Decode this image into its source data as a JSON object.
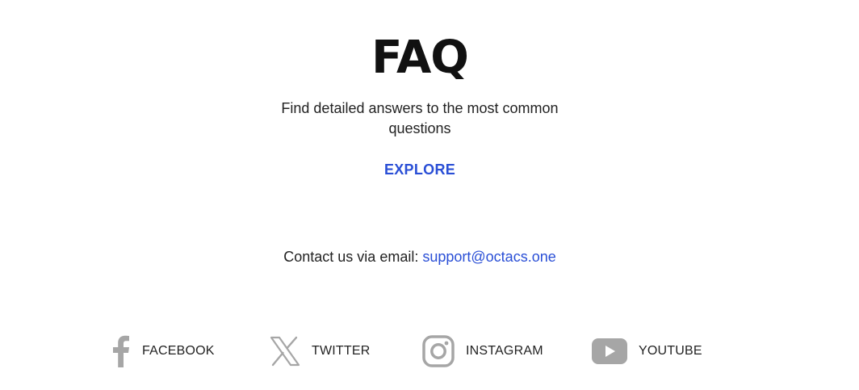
{
  "faq": {
    "title": "FAQ",
    "subtitle": "Find detailed answers to the most common questions",
    "explore_label": "EXPLORE"
  },
  "contact": {
    "prefix": "Contact us via email:",
    "email": "support@octacs.one"
  },
  "social": {
    "icon_color": "#a6a6a6",
    "items": [
      {
        "label": "FACEBOOK",
        "icon": "facebook-icon"
      },
      {
        "label": "TWITTER",
        "icon": "x-twitter-icon"
      },
      {
        "label": "INSTAGRAM",
        "icon": "instagram-icon"
      },
      {
        "label": "YOUTUBE",
        "icon": "youtube-icon"
      }
    ]
  },
  "colors": {
    "accent": "#2a4fd6",
    "text": "#222222",
    "title": "#111111",
    "background": "#ffffff"
  }
}
